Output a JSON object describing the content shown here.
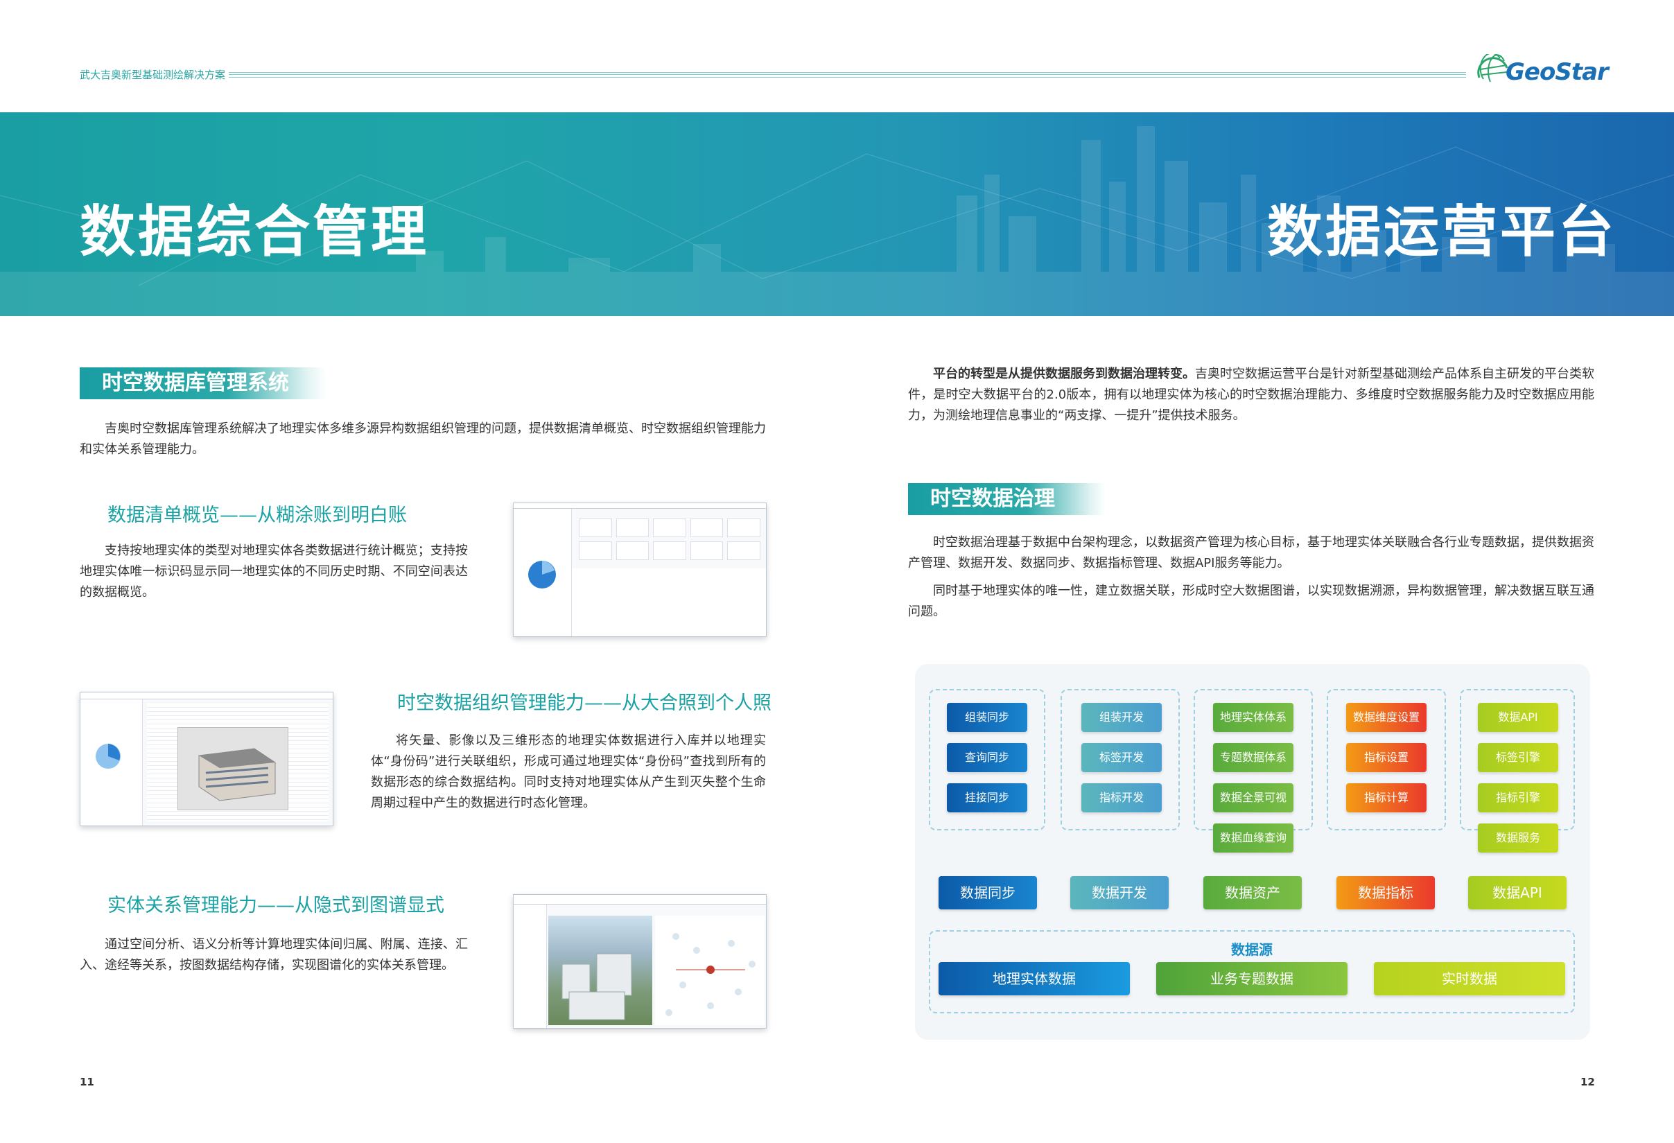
{
  "header": {
    "doc_title": "武大吉奥新型基础测绘解决方案",
    "logo_text": "GeoStar"
  },
  "banner": {
    "left_title": "数据综合管理",
    "right_title": "数据运营平台"
  },
  "left": {
    "section_title": "时空数据库管理系统",
    "intro": "吉奥时空数据库管理系统解决了地理实体多维多源异构数据组织管理的问题，提供数据清单概览、时空数据组织管理能力和实体关系管理能力。",
    "sub1": {
      "title": "数据清单概览——从糊涂账到明白账",
      "text": "支持按地理实体的类型对地理实体各类数据进行统计概览；支持按地理实体唯一标识码显示同一地理实体的不同历史时期、不同空间表达的数据概览。"
    },
    "sub2": {
      "title": "时空数据组织管理能力——从大合照到个人照",
      "text": "将矢量、影像以及三维形态的地理实体数据进行入库并以地理实体“身份码”进行关联组织，形成可通过地理实体“身份码”查找到所有的数据形态的综合数据结构。同时支持对地理实体从产生到灭失整个生命周期过程中产生的数据进行时态化管理。"
    },
    "sub3": {
      "title": "实体关系管理能力——从隐式到图谱显式",
      "text": "通过空间分析、语义分析等计算地理实体间归属、附属、连接、汇入、途经等关系，按图数据结构存储，实现图谱化的实体关系管理。"
    },
    "page_number": "11"
  },
  "right": {
    "intro_bold": "平台的转型是从提供数据服务到数据治理转变。",
    "intro_rest": "吉奥时空数据运营平台是针对新型基础测绘产品体系自主研发的平台类软件，是时空大数据平台的2.0版本，拥有以地理实体为核心的时空数据治理能力、多维度时空数据服务能力及时空数据应用能力，为测绘地理信息事业的“两支撑、一提升”提供技术服务。",
    "section_title": "时空数据治理",
    "para1": "时空数据治理基于数据中台架构理念，以数据资产管理为核心目标，基于地理实体关联融合各行业专题数据，提供数据资产管理、数据开发、数据同步、数据指标管理、数据API服务等能力。",
    "para2": "同时基于地理实体的唯一性，建立数据关联，形成时空大数据图谱，以实现数据溯源，异构数据管理，解决数据互联互通问题。",
    "page_number": "12"
  },
  "diagram": {
    "columns": [
      {
        "items": [
          "组装同步",
          "查询同步",
          "挂接同步"
        ],
        "footer": "数据同步",
        "color": "#1a85cf"
      },
      {
        "items": [
          "组装开发",
          "标签开发",
          "指标开发"
        ],
        "footer": "数据开发",
        "color": "#5bb6bc"
      },
      {
        "items": [
          "地理实体体系",
          "专题数据体系",
          "数据全景可视",
          "数据血缘查询"
        ],
        "footer": "数据资产",
        "color": "#58ab3c"
      },
      {
        "items": [
          "数据维度设置",
          "指标设置",
          "指标计算"
        ],
        "footer": "数据指标",
        "color": "#ea3a2c"
      },
      {
        "items": [
          "数据API",
          "标签引擎",
          "指标引擎",
          "数据服务"
        ],
        "footer": "数据API",
        "color": "#a6cc21"
      }
    ],
    "source_title": "数据源",
    "sources": [
      "地理实体数据",
      "业务专题数据",
      "实时数据"
    ]
  }
}
